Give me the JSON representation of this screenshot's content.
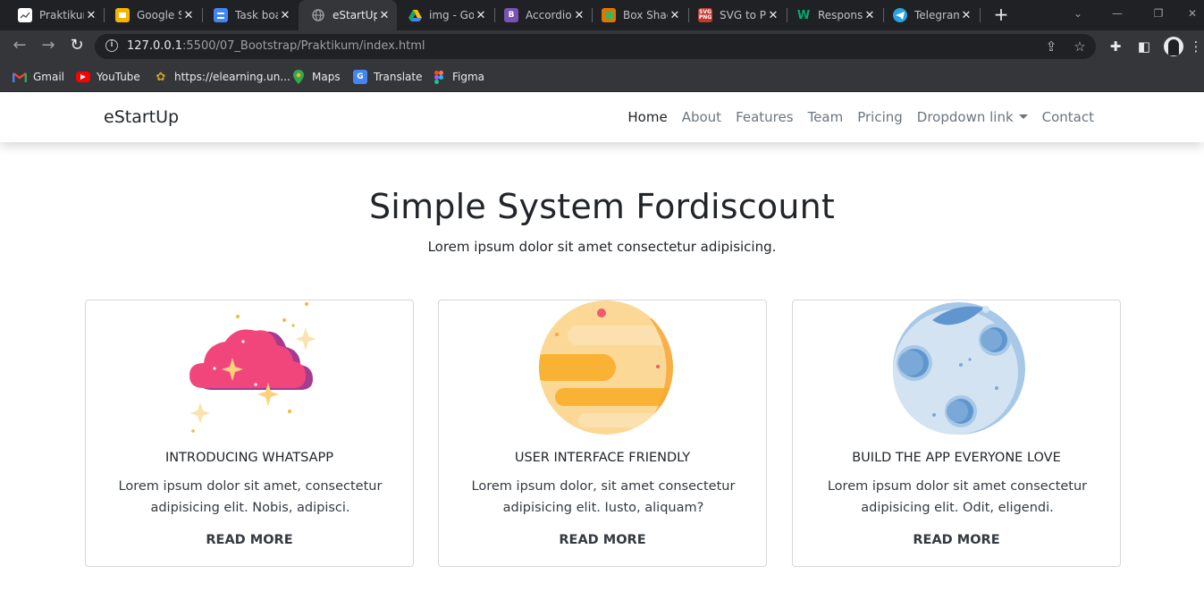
{
  "browser": {
    "tabs": [
      {
        "title": "Praktikum",
        "favicon": "chart-favicon",
        "color": "#ffffff"
      },
      {
        "title": "Google Slides",
        "favicon": "slides-favicon",
        "color": "#f4b400"
      },
      {
        "title": "Task board",
        "favicon": "docs-favicon",
        "color": "#4285f4"
      },
      {
        "title": "eStartUp",
        "favicon": "globe-favicon",
        "color": "#9aa0a6"
      },
      {
        "title": "img - Google Drive",
        "favicon": "drive-favicon",
        "color": "#1fa463"
      },
      {
        "title": "Accordion",
        "favicon": "bootstrap-favicon",
        "color": "#7952b3"
      },
      {
        "title": "Box Shadow",
        "favicon": "box-favicon",
        "color": "#e37400"
      },
      {
        "title": "SVG to PNG",
        "favicon": "svgpng-favicon",
        "color": "#c0392b"
      },
      {
        "title": "Responsive",
        "favicon": "w-favicon",
        "color": "#04aa6d"
      },
      {
        "title": "Telegram",
        "favicon": "telegram-favicon",
        "color": "#2aa3e0"
      }
    ],
    "url_host": "127.0.0.1",
    "url_rest": ":5500/07_Bootstrap/Praktikum/index.html",
    "bookmarks": [
      {
        "label": "Gmail",
        "icon": "gmail-icon",
        "color": "#ea4335"
      },
      {
        "label": "YouTube",
        "icon": "youtube-icon",
        "color": "#ff0000"
      },
      {
        "label": "https://elearning.un...",
        "icon": "elearning-icon",
        "color": "#c9a227"
      },
      {
        "label": "Maps",
        "icon": "maps-icon",
        "color": "#34a853"
      },
      {
        "label": "Translate",
        "icon": "translate-icon",
        "color": "#4285f4"
      },
      {
        "label": "Figma",
        "icon": "figma-icon",
        "color": "#f24e1e"
      }
    ]
  },
  "page": {
    "brand": "eStartUp",
    "nav": [
      {
        "label": "Home",
        "active": true
      },
      {
        "label": "About"
      },
      {
        "label": "Features"
      },
      {
        "label": "Team"
      },
      {
        "label": "Pricing"
      },
      {
        "label": "Dropdown link",
        "dropdown": true
      },
      {
        "label": "Contact"
      }
    ],
    "hero": {
      "title": "Simple System Fordiscount",
      "subtitle": "Lorem ipsum dolor sit amet consectetur adipisicing."
    },
    "cards": [
      {
        "illustration": "cloud-sparkle-illustration",
        "title": "INTRODUCING WHATSAPP",
        "text": "Lorem ipsum dolor sit amet, consectetur adipisicing elit. Nobis, adipisci.",
        "button": "READ MORE"
      },
      {
        "illustration": "planet-illustration",
        "title": "USER INTERFACE FRIENDLY",
        "text": "Lorem ipsum dolor, sit amet consectetur adipisicing elit. Iusto, aliquam?",
        "button": "READ MORE"
      },
      {
        "illustration": "moon-illustration",
        "title": "BUILD THE APP EVERYONE LOVE",
        "text": "Lorem ipsum dolor sit amet consectetur adipisicing elit. Odit, eligendi.",
        "button": "READ MORE"
      }
    ]
  }
}
